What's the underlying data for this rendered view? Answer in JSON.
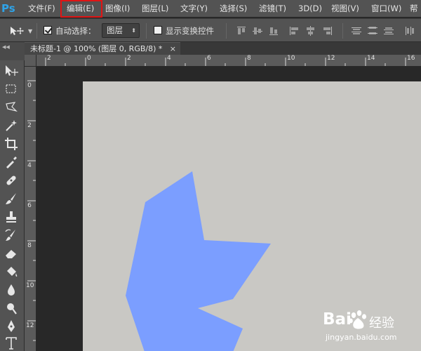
{
  "app": {
    "logo": "Ps"
  },
  "menu": {
    "items": [
      "文件(F)",
      "编辑(E)",
      "图像(I)",
      "图层(L)",
      "文字(Y)",
      "选择(S)",
      "滤镜(T)",
      "3D(D)",
      "视图(V)",
      "窗口(W)",
      "帮"
    ],
    "highlighted_index": 1,
    "highlight_color": "#e01414"
  },
  "options": {
    "auto_select_label": "自动选择：",
    "auto_select_checked": true,
    "auto_select_target": "图层",
    "show_transform_label": "显示变换控件",
    "show_transform_checked": false
  },
  "document": {
    "tab_title": "未标题-1 @ 100% (图层 0, RGB/8) *",
    "close_glyph": "×"
  },
  "rulers": {
    "horizontal": [
      "2",
      "0",
      "2",
      "4",
      "6",
      "8",
      "10",
      "12",
      "14",
      "16"
    ],
    "vertical": [
      "0",
      "2",
      "4",
      "6",
      "8",
      "10",
      "12"
    ]
  },
  "canvas": {
    "background": "#c9c8c4",
    "shape_color": "#7b9eff"
  },
  "colors": {
    "chrome": "#535353",
    "workspace": "#282828",
    "ps_blue": "#2fa3e8"
  },
  "tools": [
    "move-tool",
    "marquee-tool",
    "lasso-tool",
    "magic-wand-tool",
    "crop-tool",
    "eyedropper-tool",
    "healing-brush-tool",
    "brush-tool",
    "clone-stamp-tool",
    "history-brush-tool",
    "eraser-tool",
    "paint-bucket-tool",
    "blur-tool",
    "dodge-tool",
    "pen-tool",
    "type-tool"
  ],
  "watermark": {
    "brand": "Bai",
    "brand_suffix": "经验",
    "url": "jingyan.baidu.com"
  }
}
